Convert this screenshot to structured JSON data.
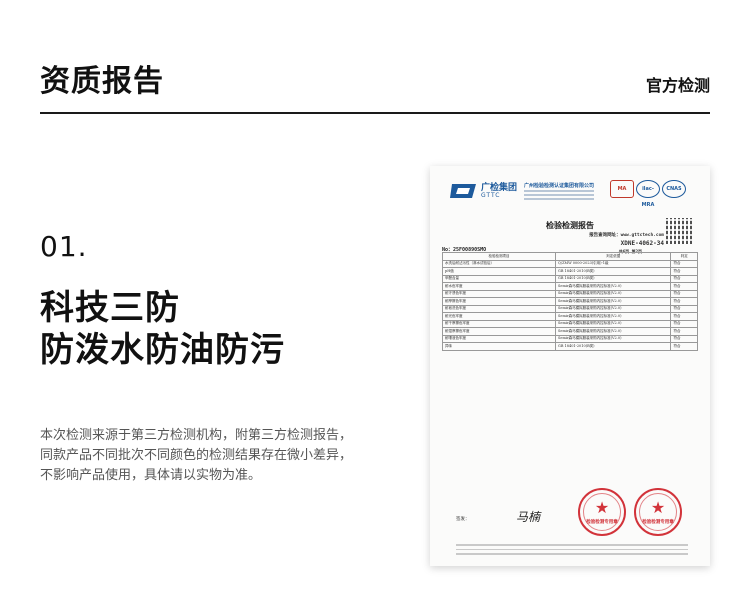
{
  "header": {
    "title": "资质报告",
    "right_label": "官方检测"
  },
  "section": {
    "number": "01.",
    "heading_line1": "科技三防",
    "heading_line2": "防泼水防油防污",
    "description": [
      "本次检测来源于第三方检测机构，附第三方检测报告，",
      "同款产品不同批次不同颜色的检测结果存在微小差异，",
      "不影响产品使用，具体请以实物为准。"
    ]
  },
  "report": {
    "brand_cn": "广检集团",
    "brand_en": "GTTC",
    "company": "广州检验检测认证集团有限公司",
    "cert_ma": "MA",
    "cert_ilac": "ilac-MRA",
    "cert_cnas": "CNAS",
    "title": "检验检测报告",
    "query_site": "报告查询网址：www.gttctech.com",
    "report_no": "XDNE-4062-34",
    "page": "共6页 第2页",
    "sample_no": "No：25F00890SMO",
    "table": {
      "headers": [
        "检验检测项目",
        "判定依据",
        "判定"
      ],
      "rows": [
        [
          "水洗后耐沾污性（淋水试验后）",
          "Q/ZMW 0000-2023(引用)-1级",
          "符合"
        ],
        [
          "pH值",
          "GB 18401-2010(B类)",
          "符合"
        ],
        [
          "甲醛含量",
          "GB 18401-2010(B类)",
          "符合"
        ],
        [
          "耐水色牢度",
          "Semir森马模拟服装采购内控标准(V2.0)",
          "符合"
        ],
        [
          "耐汗渍色牢度",
          "Semir森马模拟服装采购内控标准(V2.0)",
          "符合"
        ],
        [
          "耐摩擦色牢度",
          "Semir森马模拟服装采购内控标准(V2.0)",
          "符合"
        ],
        [
          "耐皂洗色牢度",
          "Semir森马模拟服装采购内控标准(V2.0)",
          "符合"
        ],
        [
          "耐光色牢度",
          "Semir森马模拟服装采购内控标准(V2.0)",
          "符合"
        ],
        [
          "耐干摩擦色牢度",
          "Semir森马模拟服装采购内控标准(V2.0)",
          "符合"
        ],
        [
          "耐湿摩擦色牢度",
          "Semir森马模拟服装采购内控标准(V2.0)",
          "符合"
        ],
        [
          "耐唾液色牢度",
          "Semir森马模拟服装采购内控标准(V2.0)",
          "符合"
        ],
        [
          "异味",
          "GB 18401-2010(B类)",
          "符合"
        ]
      ]
    },
    "sign_label": "签发：",
    "signature": "马楠",
    "stamp1_text": "检验检测专用章",
    "stamp2_text": "检验检测专用章"
  }
}
